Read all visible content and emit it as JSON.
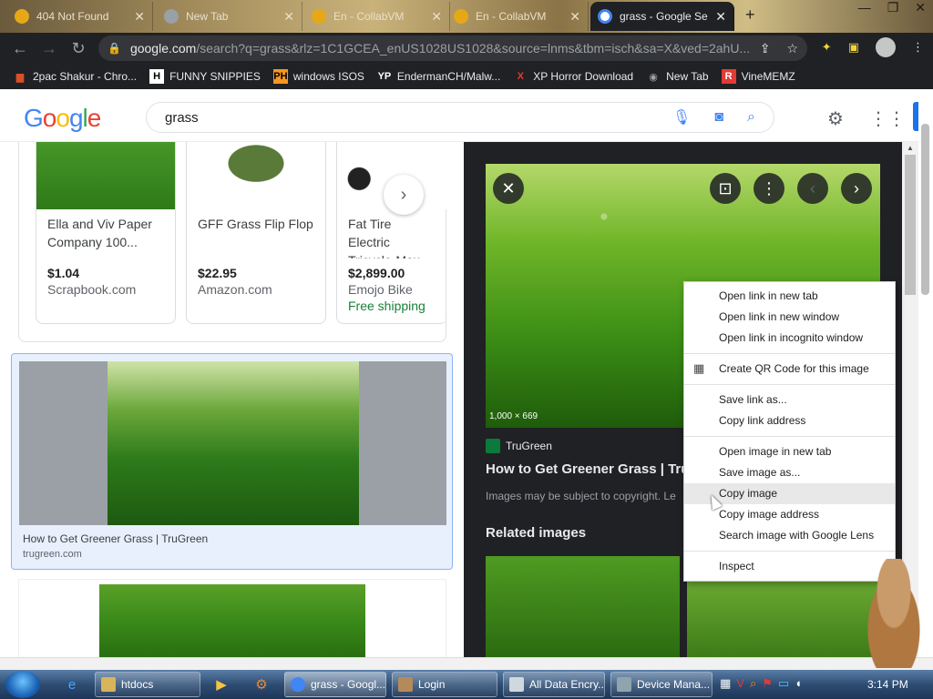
{
  "tabs": [
    {
      "title": "404 Not Found",
      "fav_color": "#e6a817"
    },
    {
      "title": "New Tab",
      "fav_color": "#9aa0a6"
    },
    {
      "title": "En - CollabVM",
      "fav_color": "#e6a817"
    },
    {
      "title": "En - CollabVM",
      "fav_color": "#e6a817"
    },
    {
      "title": "grass - Google Se",
      "fav_color": "#4285f4"
    }
  ],
  "address_bar": {
    "url_main": "google.com",
    "url_rest": "/search?q=grass&rlz=1C1GCEA_enUS1028US1028&source=lnms&tbm=isch&sa=X&ved=2ahU..."
  },
  "bookmarks": [
    {
      "label": "2pac Shakur - Chro...",
      "icon": "T",
      "color": "#d94f2a"
    },
    {
      "label": "FUNNY SNIPPIES",
      "icon": "H",
      "color": "#ffffff"
    },
    {
      "label": "windows ISOS",
      "icon": "PH",
      "color": "#f7971d"
    },
    {
      "label": "EndermanCH/Malw...",
      "icon": "YP",
      "color": "#ffffff"
    },
    {
      "label": "XP Horror Download",
      "icon": "X",
      "color": "#e53935"
    },
    {
      "label": "New Tab",
      "icon": "◉",
      "color": "#9aa0a6"
    },
    {
      "label": "VineMEMZ",
      "icon": "R",
      "color": "#e53935"
    }
  ],
  "search": {
    "query": "grass"
  },
  "shopping": [
    {
      "name": "Ella and Viv Paper Company 100...",
      "price": "$1.04",
      "store": "Scrapbook.com",
      "shipping": ""
    },
    {
      "name": "GFF Grass Flip Flop",
      "price": "$22.95",
      "store": "Amazon.com",
      "shipping": ""
    },
    {
      "name": "Fat Tire Electric Tricycle-Max Spe",
      "price": "$2,899.00",
      "store": "Emojo Bike",
      "shipping": "Free shipping"
    }
  ],
  "selected_result": {
    "caption": "How to Get Greener Grass | TruGreen",
    "domain": "trugreen.com"
  },
  "preview": {
    "dimensions": "1,000 × 669",
    "source": "TruGreen",
    "title": "How to Get Greener Grass | TruG",
    "copyright": "Images may be subject to copyright. Le",
    "related": "Related images"
  },
  "context_menu": {
    "groups": [
      [
        "Open link in new tab",
        "Open link in new window",
        "Open link in incognito window"
      ],
      [
        "Create QR Code for this image"
      ],
      [
        "Save link as...",
        "Copy link address"
      ],
      [
        "Open image in new tab",
        "Save image as...",
        "Copy image",
        "Copy image address",
        "Search image with Google Lens"
      ],
      [
        "Inspect"
      ]
    ],
    "hovered": "Copy image"
  },
  "taskbar": {
    "tasks": [
      {
        "label": "htdocs",
        "color": "#d8b45a"
      },
      {
        "label": "grass - Googl...",
        "color": "#4285f4",
        "active": true
      },
      {
        "label": "Login",
        "color": "#b58a5a"
      },
      {
        "label": "All Data Encry...",
        "color": "#cfd8dc"
      },
      {
        "label": "Device Mana...",
        "color": "#90a4ae"
      }
    ],
    "time": "3:14 PM"
  },
  "colors": {
    "accent": "#1a73e8",
    "preview_bg": "#202124",
    "chrome_bar": "#202124"
  }
}
